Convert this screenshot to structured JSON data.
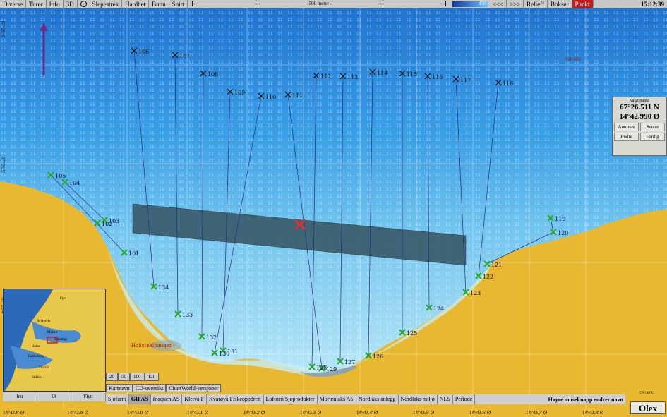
{
  "menu": {
    "items": [
      "Diverse",
      "Turer",
      "Info",
      "3D",
      "Slepestrek",
      "Hardhet",
      "Bunn",
      "Snitt"
    ],
    "scale_label": "500 meter",
    "depth_max": "450",
    "nav_prev": "<<<",
    "nav_next": ">>>",
    "relief": "Relieff",
    "bokser": "Bokser",
    "punkt": "Punkt",
    "clock": "15:12:39"
  },
  "panel": {
    "title": "Valgt punkt",
    "lat": "67°26.511 N",
    "lon": "14°42.990 Ø",
    "buttons": [
      "Autonav",
      "Senter",
      "Endre",
      "Ferdig"
    ]
  },
  "waypoints_north": [
    "106",
    "107",
    "108",
    "109",
    "110",
    "111",
    "112",
    "113",
    "114",
    "115",
    "116",
    "117",
    "118"
  ],
  "waypoints_south": [
    "105",
    "104",
    "103",
    "102",
    "101",
    "134",
    "133",
    "132",
    "131",
    "130",
    "129",
    "128",
    "127",
    "126",
    "125",
    "124",
    "123",
    "122",
    "121",
    "120",
    "119"
  ],
  "place_labels": [
    "Hollstehlhaugen",
    "Saltsfal"
  ],
  "inset": {
    "labels": [
      "Fjær",
      "Mitterelv",
      "Myken",
      "Karstrug",
      "Bodø",
      "Valvika",
      "Skålvei",
      "Løkkeborg"
    ],
    "buttons": [
      "Inn",
      "Ut",
      "Flytt"
    ]
  },
  "small_tabs": [
    "20",
    "50",
    "100",
    "Tall"
  ],
  "sub_tabs": [
    "Kartnavn",
    "CD-oversikt",
    "ChartWorld-versjoner"
  ],
  "bottom_tabs": [
    "Sjøfarm",
    "GIFAS",
    "Inaquen AS",
    "Kleiva F",
    "Kvarøya Fiskeoppdrett",
    "Lofoten Sjøprodukter",
    "Mortenlaks AS",
    "Nordlaks anlegg",
    "Nordlaks miljø",
    "NLS",
    "Periode"
  ],
  "bottom_selected": "GIFAS",
  "hint": "Høyre museknapp endrer navn",
  "brand": "Olex",
  "cpu": "CPU 40°C",
  "bottom_axis": [
    "14°42.8' Ø",
    "14°42.9' Ø",
    "14°43.0' Ø",
    "14°43.1' Ø",
    "14°43.2' Ø",
    "14°43.3' Ø",
    "14°43.4' Ø",
    "14°43.5' Ø",
    "14°43.6' Ø",
    "14°43.7' Ø",
    "14°43.8' Ø"
  ],
  "left_axis": [
    "67°26.6'",
    "67°26.5'",
    "67°26.4'"
  ],
  "colors": {
    "land": "#e8b830",
    "deep": "#1f74d0",
    "shallow": "#9ad8f0",
    "selection": "#385a6a",
    "waypoint": "#2aa832",
    "marker": "#e03030"
  }
}
